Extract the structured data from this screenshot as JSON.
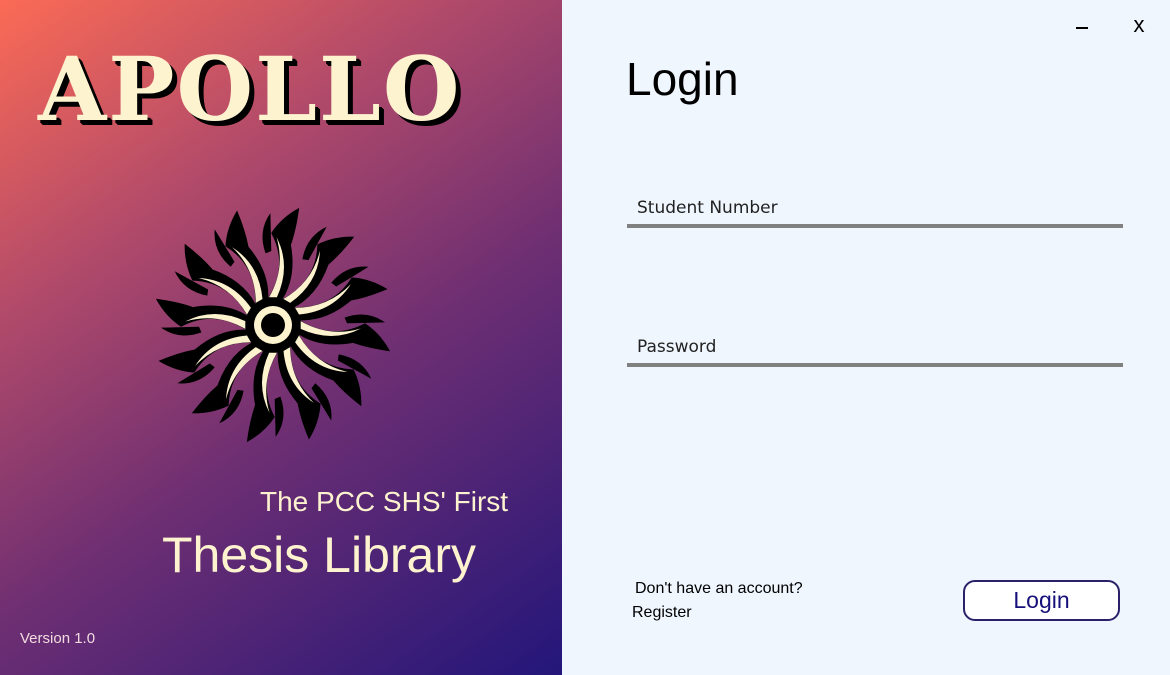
{
  "brand": {
    "title": "APOLLO",
    "logo_icon": "sun-icon",
    "tagline": "The PCC SHS' First",
    "subtitle": "Thesis Library",
    "version": "Version 1.0"
  },
  "window": {
    "minimize_label": "–",
    "close_label": "x"
  },
  "login": {
    "heading": "Login",
    "student_number": {
      "placeholder": "Student Number",
      "value": ""
    },
    "password": {
      "placeholder": "Password",
      "value": ""
    },
    "no_account_text": "Don't have an account?",
    "register_label": "Register",
    "button_label": "Login"
  },
  "colors": {
    "gradient_start": "#fb6b55",
    "gradient_end": "#23167a",
    "cream": "#fdf3cf",
    "panel_bg": "#eff6fe",
    "button_border": "#2a2168",
    "button_text": "#16107a"
  }
}
